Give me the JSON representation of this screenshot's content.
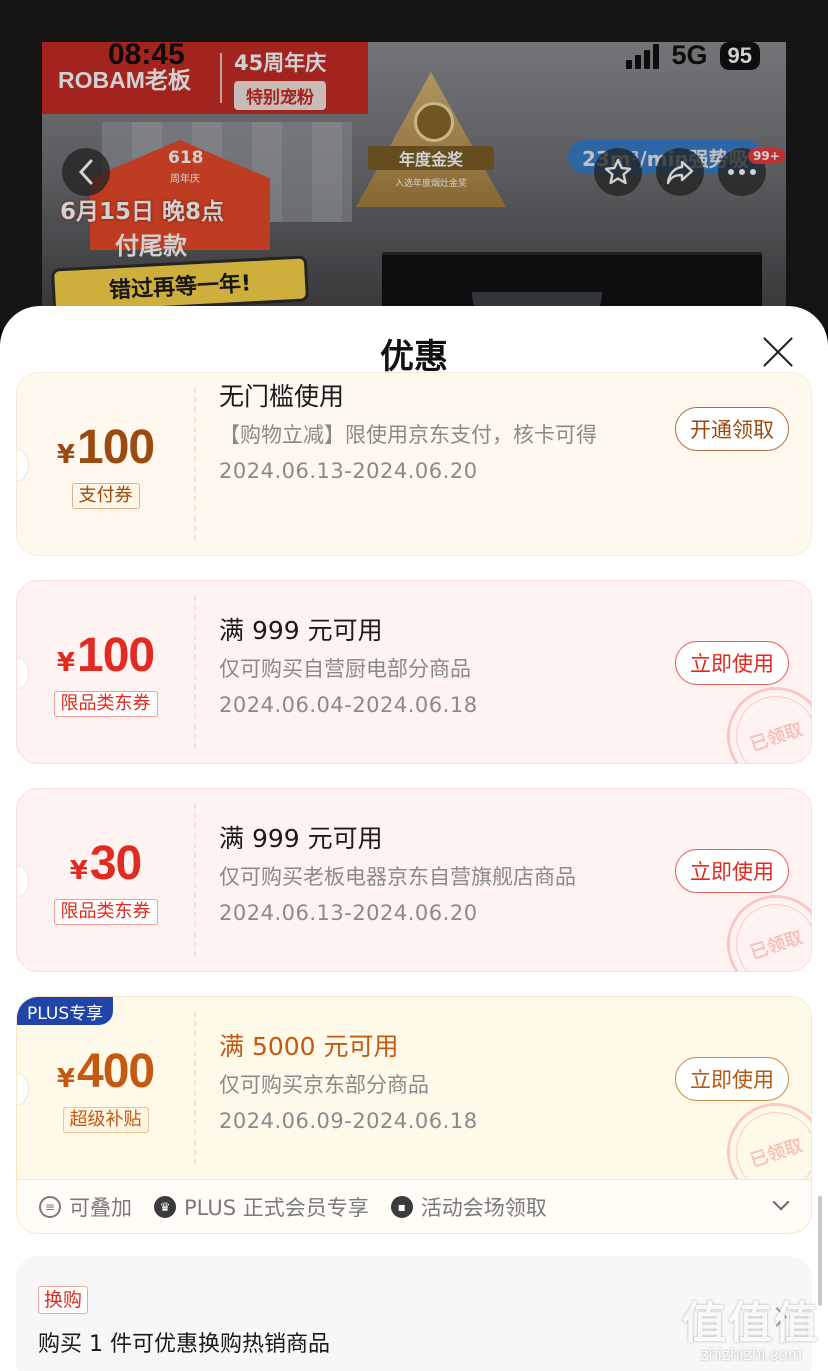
{
  "status_bar": {
    "time": "08:45",
    "network": "5G",
    "battery": "95"
  },
  "hero": {
    "brand_logo": "ROBAM老板",
    "anniversary": "45周年庆",
    "anniversary_pill": "特别宠粉",
    "promo_618": "618",
    "promo_618_sub": "周年庆",
    "promo_line1": "6月15日 晚8点",
    "promo_line2": "付尾款",
    "promo_ribbon": "错过再等一年!",
    "award_title": "年度金奖",
    "award_sub": "入选年度烟灶金奖",
    "blue_badge": "23m³/min强势吸",
    "more_badge": "99+"
  },
  "sheet": {
    "title": "优惠"
  },
  "coupons": [
    {
      "currency": "¥",
      "amount": "100",
      "tag": "支付券",
      "title": "无门槛使用",
      "desc": "【购物立减】限使用京东支付，核卡可得",
      "date": "2024.06.13-2024.06.20",
      "button": "开通领取",
      "stamp": ""
    },
    {
      "currency": "¥",
      "amount": "100",
      "tag": "限品类东券",
      "title": "满 999 元可用",
      "desc": "仅可购买自营厨电部分商品",
      "date": "2024.06.04-2024.06.18",
      "button": "立即使用",
      "stamp": "已领取"
    },
    {
      "currency": "¥",
      "amount": "30",
      "tag": "限品类东券",
      "title": "满 999 元可用",
      "desc": "仅可购买老板电器京东自营旗舰店商品",
      "date": "2024.06.13-2024.06.20",
      "button": "立即使用",
      "stamp": "已领取"
    },
    {
      "badge": "PLUS专享",
      "currency": "¥",
      "amount": "400",
      "tag": "超级补贴",
      "title": "满 5000 元可用",
      "desc": "仅可购买京东部分商品",
      "date": "2024.06.09-2024.06.18",
      "button": "立即使用",
      "stamp": "已领取"
    }
  ],
  "coupon_features": [
    "可叠加",
    "PLUS 正式会员专享",
    "活动会场领取"
  ],
  "exchange": {
    "tag": "换购",
    "title": "购买 1 件可优惠换购热销商品"
  },
  "watermark": {
    "logo": "值值值",
    "url": "zhizhizhi.com"
  },
  "colors": {
    "red": "#e02a22",
    "brown": "#9b4a12",
    "orange": "#c45a12",
    "plus_blue": "#2144a8",
    "banner_red": "#c72c25"
  }
}
